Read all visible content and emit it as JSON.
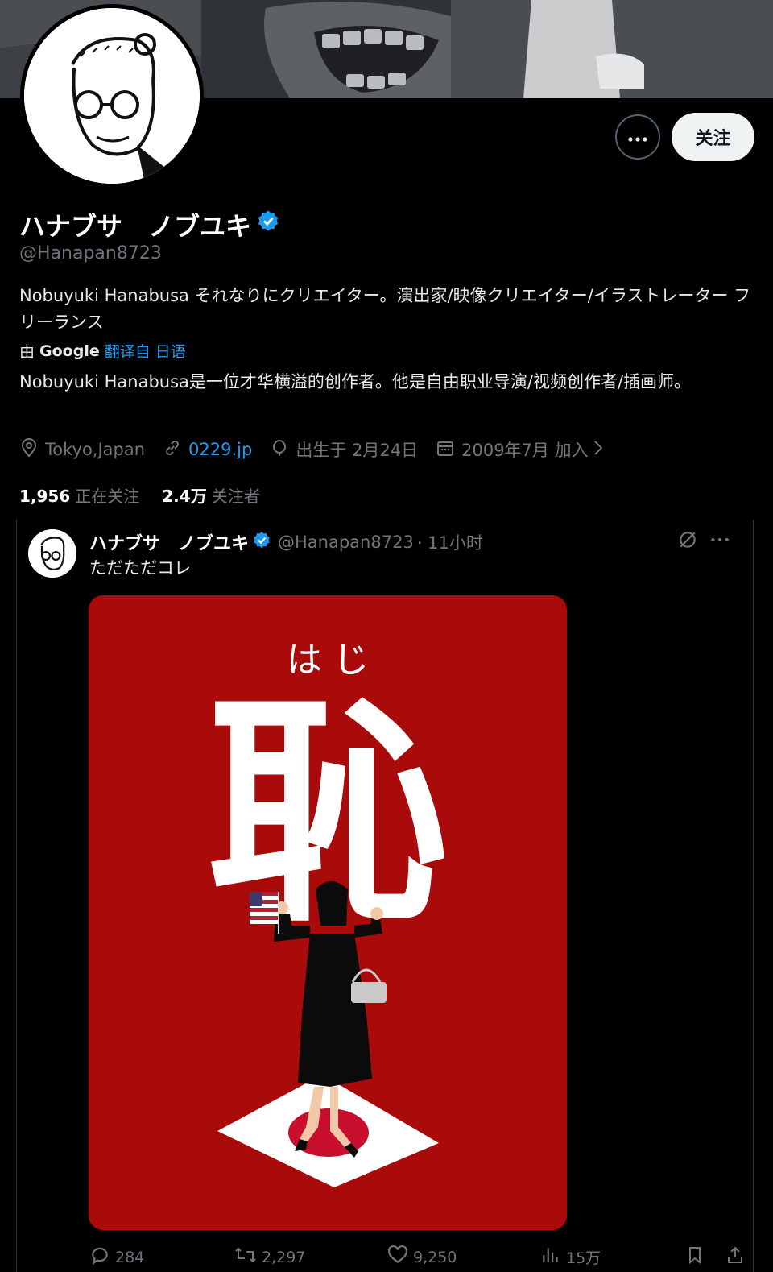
{
  "profile": {
    "display_name": "ハナブサ　ノブユキ",
    "handle": "@Hanapan8723",
    "follow_label": "关注",
    "bio": "Nobuyuki Hanabusa それなりにクリエイター。演出家/映像クリエイター/イラストレーター フリーランス",
    "translated_by_prefix": "由",
    "translated_by_brand": "Google",
    "translated_from": "翻译自 日语",
    "bio_translated": "Nobuyuki Hanabusa是一位才华横溢的创作者。他是自由职业导演/视频创作者/插画师。",
    "location": "Tokyo,Japan",
    "website": "0229.jp",
    "birthday": "出生于 2月24日",
    "joined": "2009年7月 加入",
    "following_count": "1,956",
    "following_label": "正在关注",
    "followers_count": "2.4万",
    "followers_label": "关注者"
  },
  "tweet": {
    "author_name": "ハナブサ　ノブユキ",
    "author_handle": "@Hanapan8723",
    "time": "· 11小时",
    "text": "ただただコレ",
    "image_text_kana": "は じ",
    "image_text_kanji": "恥",
    "replies": "284",
    "retweets": "2,297",
    "likes": "9,250",
    "views": "15万"
  },
  "colors": {
    "accent": "#1d9bf0",
    "background": "#000000",
    "image_red": "#a90a0a"
  },
  "icons": [
    "more-icon",
    "verified-icon",
    "location-icon",
    "link-icon",
    "birthday-icon",
    "calendar-icon",
    "chevron-right-icon",
    "grok-icon",
    "reply-icon",
    "retweet-icon",
    "like-icon",
    "views-icon",
    "bookmark-icon",
    "share-icon"
  ]
}
